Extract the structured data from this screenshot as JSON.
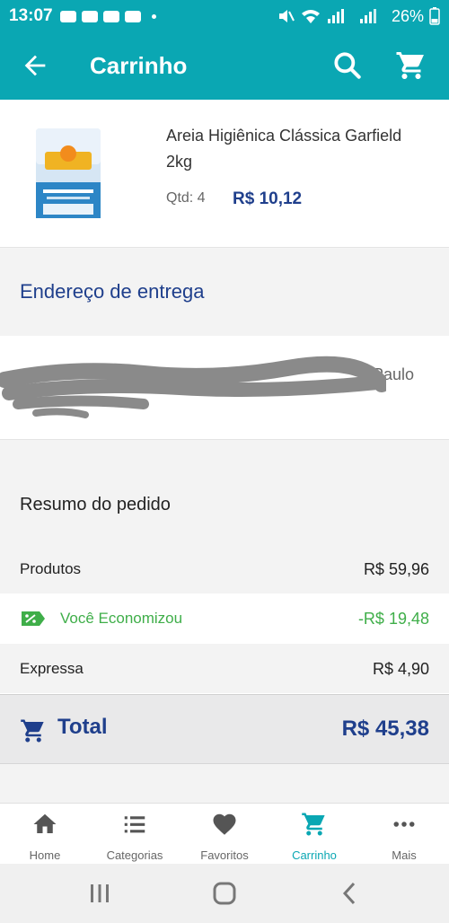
{
  "status_bar": {
    "time": "13:07",
    "battery": "26%"
  },
  "app_bar": {
    "title": "Carrinho"
  },
  "product": {
    "name": "Areia Higiênica Clássica Garfield 2kg",
    "qty_label": "Qtd: 4",
    "price": "R$ 10,12"
  },
  "address": {
    "heading": "Endereço de entrega",
    "visible_text": "o Paulo"
  },
  "summary": {
    "heading": "Resumo do pedido",
    "produtos_label": "Produtos",
    "produtos_value": "R$ 59,96",
    "savings_label": "Você Economizou",
    "savings_value": "-R$ 19,48",
    "express_label": "Expressa",
    "express_value": "R$ 4,90",
    "total_label": "Total",
    "total_value": "R$ 45,38"
  },
  "bottom_nav": {
    "home": "Home",
    "categorias": "Categorias",
    "favoritos": "Favoritos",
    "carrinho": "Carrinho",
    "mais": "Mais"
  },
  "colors": {
    "accent": "#0aa7b3",
    "brand_blue": "#1f3f8c",
    "savings_green": "#3fae49"
  },
  "icons": [
    "back-arrow-icon",
    "search-icon",
    "cart-icon",
    "discount-tag-icon",
    "home-icon",
    "list-icon",
    "heart-icon",
    "more-icon"
  ]
}
